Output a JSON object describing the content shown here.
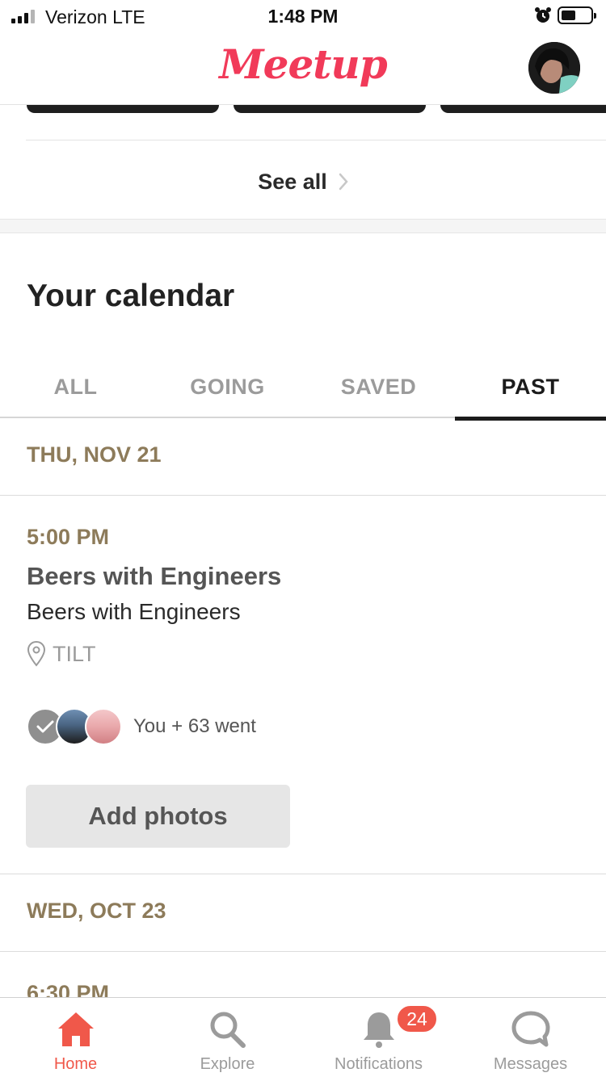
{
  "status_bar": {
    "carrier": "Verizon  LTE",
    "time": "1:48 PM"
  },
  "header": {
    "logo_text": "Meetup"
  },
  "see_all": {
    "label": "See all"
  },
  "calendar": {
    "title": "Your calendar",
    "tabs": [
      {
        "label": "ALL",
        "active": false
      },
      {
        "label": "GOING",
        "active": false
      },
      {
        "label": "SAVED",
        "active": false
      },
      {
        "label": "PAST",
        "active": true
      }
    ],
    "groups": [
      {
        "date": "THU, NOV 21",
        "event": {
          "time": "5:00 PM",
          "title": "Beers with Engineers",
          "group_name": "Beers with Engineers",
          "venue": "TILT",
          "attendance": "You + 63 went",
          "action_label": "Add photos"
        }
      },
      {
        "date": "WED, OCT 23",
        "event": {
          "time": "6:30 PM"
        }
      }
    ]
  },
  "bottom_nav": {
    "items": [
      {
        "label": "Home",
        "icon": "home-icon",
        "active": true
      },
      {
        "label": "Explore",
        "icon": "search-icon",
        "active": false
      },
      {
        "label": "Notifications",
        "icon": "bell-icon",
        "active": false,
        "badge": "24"
      },
      {
        "label": "Messages",
        "icon": "chat-bubble-icon",
        "active": false
      }
    ]
  },
  "colors": {
    "brand": "#f13a59",
    "accent_nav": "#f0584a",
    "date_gold": "#8d7b5a",
    "tab_active": "#1b1b1b",
    "tab_inactive": "#9b9b9b"
  }
}
